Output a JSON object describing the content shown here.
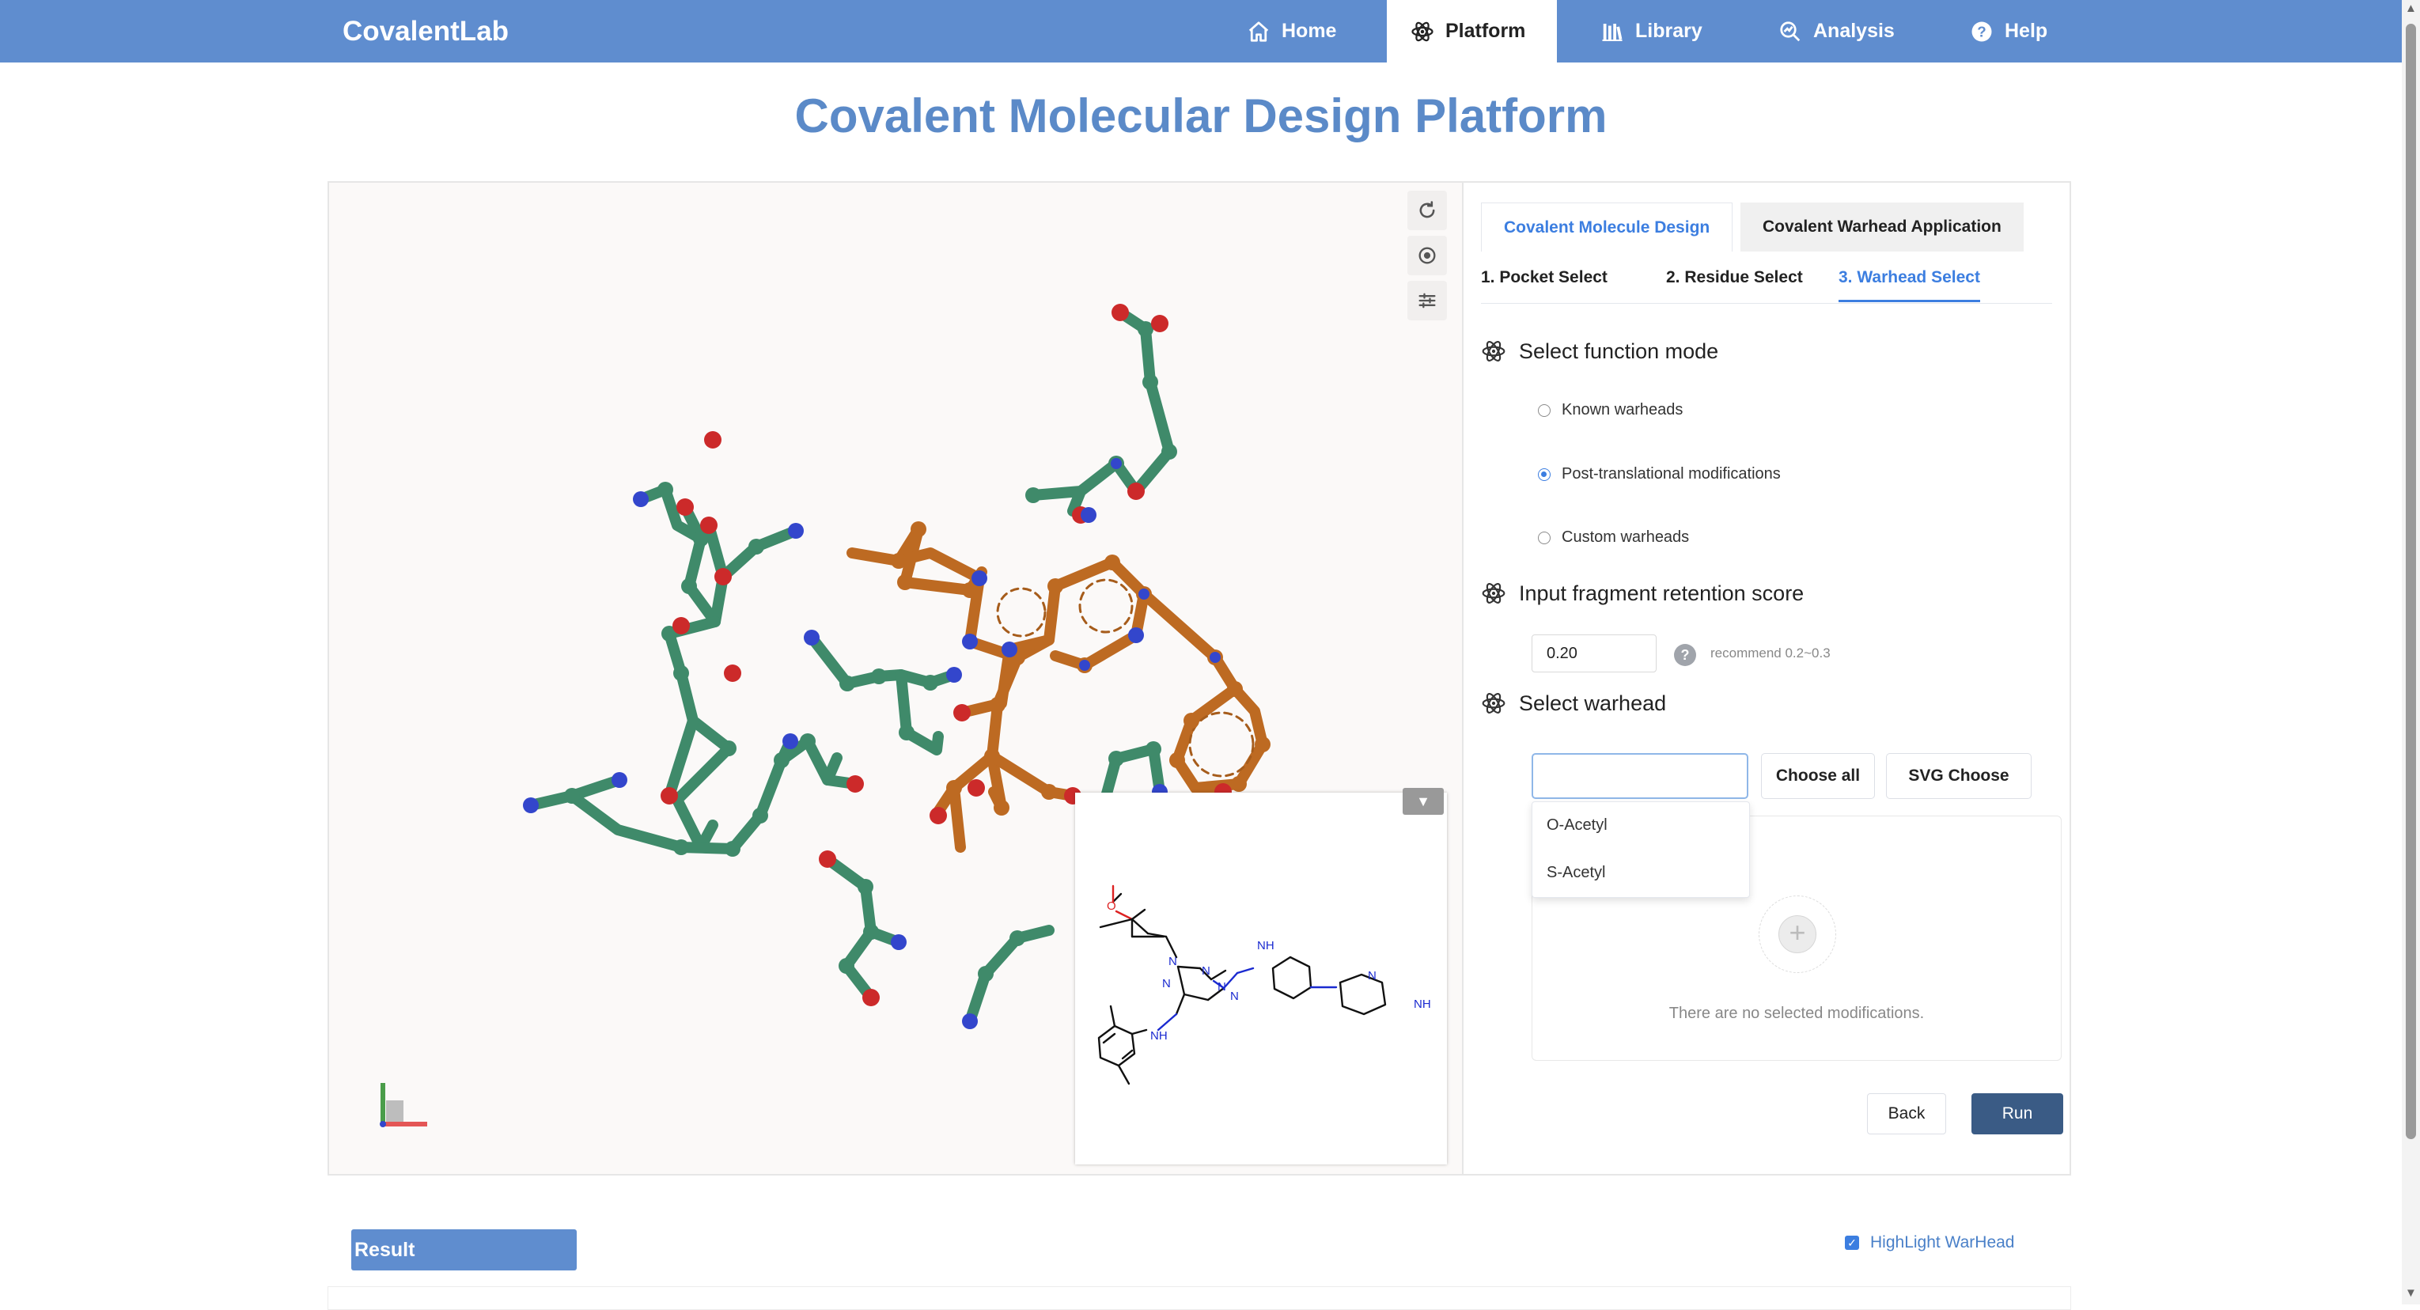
{
  "app": {
    "brand": "CovalentLab"
  },
  "nav": [
    {
      "label": "Home",
      "icon": "home-icon"
    },
    {
      "label": "Platform",
      "icon": "atom-icon",
      "active": true
    },
    {
      "label": "Library",
      "icon": "library-icon"
    },
    {
      "label": "Analysis",
      "icon": "analysis-icon"
    },
    {
      "label": "Help",
      "icon": "help-circle-icon"
    }
  ],
  "page": {
    "title": "Covalent Molecular Design Platform"
  },
  "tabs": [
    {
      "label": "Covalent Molecule Design",
      "active": true
    },
    {
      "label": "Covalent Warhead Application",
      "active": false
    }
  ],
  "steps": [
    {
      "label": "1. Pocket Select"
    },
    {
      "label": "2. Residue Select"
    },
    {
      "label": "3. Warhead Select",
      "active": true
    }
  ],
  "function_mode": {
    "heading": "Select function mode",
    "options": [
      {
        "label": "Known warheads",
        "selected": false
      },
      {
        "label": "Post-translational modifications",
        "selected": true
      },
      {
        "label": "Custom warheads",
        "selected": false
      }
    ]
  },
  "retention": {
    "heading": "Input fragment retention score",
    "value": "0.20",
    "help": "?",
    "hint": "recommend 0.2~0.3"
  },
  "warhead": {
    "heading": "Select warhead",
    "input_value": "",
    "choose_all": "Choose all",
    "svg_choose": "SVG Choose",
    "dropdown": [
      "O-Acetyl",
      "S-Acetyl"
    ],
    "empty_text": "There are no selected modifications."
  },
  "actions": {
    "back": "Back",
    "run": "Run"
  },
  "result": {
    "label": "Result",
    "highlight_label": "HighLight WarHead",
    "highlight_checked": true
  },
  "molecule_2d": {
    "atom_labels": [
      "O",
      "N",
      "N",
      "N",
      "N",
      "N",
      "NH",
      "NH",
      "N",
      "NH"
    ]
  },
  "colors": {
    "navbar": "#5f8dcf",
    "accent": "#3c7ee0",
    "residue_carbon": "#3f8a6a",
    "ligand_carbon": "#bd6a22",
    "oxygen": "#cc2a2a",
    "nitrogen": "#3346cc",
    "run_button": "#3a5b85"
  }
}
